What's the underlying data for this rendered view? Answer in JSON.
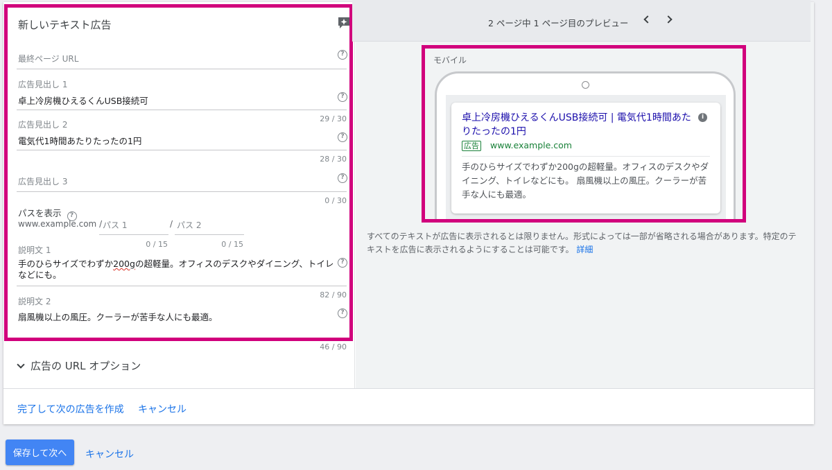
{
  "form": {
    "title": "新しいテキスト広告",
    "final_url": {
      "placeholder": "最終ページ URL"
    },
    "headline1": {
      "label": "広告見出し 1",
      "value": "卓上冷房機ひえるくんUSB接続可",
      "counter": "29 / 30"
    },
    "headline2": {
      "label": "広告見出し 2",
      "value": "電気代1時間あたりたったの1円",
      "counter": "28 / 30"
    },
    "headline3": {
      "label": "広告見出し 3",
      "value": "",
      "counter": "0 / 30"
    },
    "path": {
      "label": "パスを表示",
      "domain": "www.example.com /",
      "path1_placeholder": "パス 1",
      "separator": "/",
      "path2_placeholder": "パス 2",
      "path1_counter": "0 / 15",
      "path2_counter": "0 / 15"
    },
    "desc1": {
      "label": "説明文 1",
      "value_pre": "手のひらサイズでわずか",
      "value_err": "200g",
      "value_post": "の超軽量。オフィスのデスクやダイニング、トイレなどにも。",
      "counter": "82 / 90"
    },
    "desc2": {
      "label": "説明文 2",
      "value": "扇風機以上の風圧。クーラーが苦手な人にも最適。",
      "counter": "46 / 90"
    },
    "url_options": "広告の URL オプション",
    "help_glyph": "?"
  },
  "footer": {
    "done_label": "完了して次の広告を作成",
    "cancel_label": "キャンセル"
  },
  "preview": {
    "header": "2 ページ中 1 ページ目のプレビュー",
    "mobile_label": "モバイル",
    "ad": {
      "title": "卓上冷房機ひえるくんUSB接続可 | 電気代1時間あたりたったの1円",
      "badge": "広告",
      "url": "www.example.com",
      "description": "手のひらサイズでわずか200gの超軽量。オフィスのデスクやダイニング、トイレなどにも。 扇風機以上の風圧。クーラーが苦手な人にも最適。",
      "info_glyph": "i"
    },
    "note": "すべてのテキストが広告に表示されるとは限りません。形式によっては一部が省略される場合があります。特定のテキストを広告に表示されるようにすることは可能です。",
    "note_link": "詳細"
  },
  "bottom": {
    "save_label": "保存して次へ",
    "cancel_label": "キャンセル"
  },
  "colors": {
    "highlight": "#d1007c",
    "link": "#1a73e8",
    "ad_title": "#1a0dab",
    "ad_green": "#188038",
    "primary": "#4285f4"
  }
}
